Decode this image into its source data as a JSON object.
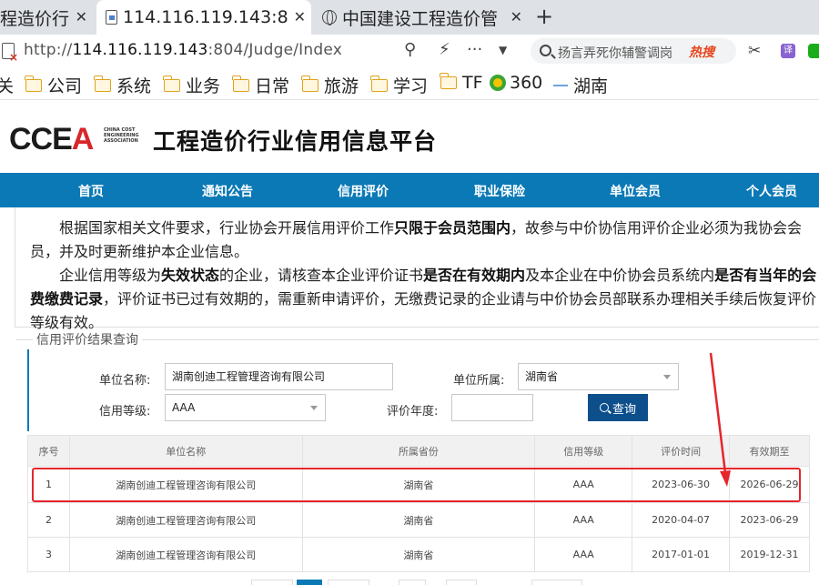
{
  "browser": {
    "tabs": [
      {
        "label": "程造价行",
        "active": false
      },
      {
        "label": "114.116.119.143:8",
        "active": true
      },
      {
        "label": "中国建设工程造价管",
        "active": false
      }
    ],
    "url_prefix": "http://",
    "url_host": "114.116.119.143",
    "url_rest": ":804/Judge/Index",
    "search_placeholder": "扬言弄死你辅警调岗",
    "search_hot": "热搜",
    "translate_label": "译",
    "bookmarks": [
      "关",
      "公司",
      "系统",
      "业务",
      "日常",
      "旅游",
      "学习",
      "TF",
      "360",
      "湖南"
    ]
  },
  "site": {
    "logo_text": "CCEA",
    "logo_sub": "CHINA COST ENGINEERING ASSOCIATION",
    "title": "工程造价行业信用信息平台",
    "nav": [
      "首页",
      "通知公告",
      "信用评价",
      "职业保险",
      "单位会员",
      "个人会员"
    ]
  },
  "notice": {
    "p1_a": "根据国家相关文件要求，行业协会开展信用评价工作",
    "p1_b": "只限于会员范围内",
    "p1_c": "，故参与中价协信用评价企业必须为我协会会员，并及时更新维护本企业信息。",
    "p2_a": "企业信用等级为",
    "p2_b": "失效状态",
    "p2_c": "的企业，请核查本企业评价证书",
    "p2_d": "是否在有效期内",
    "p2_e": "及本企业在中价协会员系统内",
    "p2_f": "是否有当年的会费缴费记录",
    "p2_g": "，评价证书已过有效期的，需重新申请评价，无缴费记录的企业请与中价协会员部联系办理相关手续后恢复评价等级有效。"
  },
  "query": {
    "legend": "信用评价结果查询",
    "unit_name_label": "单位名称:",
    "unit_name_value": "湖南创迪工程管理咨询有限公司",
    "region_label": "单位所属:",
    "region_value": "湖南省",
    "level_label": "信用等级:",
    "level_value": "AAA",
    "year_label": "评价年度:",
    "year_value": "",
    "search_button": "查询"
  },
  "table": {
    "headers": [
      "序号",
      "单位名称",
      "所属省份",
      "信用等级",
      "评价时间",
      "有效期至"
    ],
    "rows": [
      [
        "1",
        "湖南创迪工程管理咨询有限公司",
        "湖南省",
        "AAA",
        "2023-06-30",
        "2026-06-29"
      ],
      [
        "2",
        "湖南创迪工程管理咨询有限公司",
        "湖南省",
        "AAA",
        "2020-04-07",
        "2023-06-29"
      ],
      [
        "3",
        "湖南创迪工程管理咨询有限公司",
        "湖南省",
        "AAA",
        "2017-01-01",
        "2019-12-31"
      ]
    ],
    "highlighted_row": 1
  },
  "colors": {
    "nav": "#0a79b5",
    "button": "#0d4f8b",
    "highlight": "#e5262b"
  }
}
